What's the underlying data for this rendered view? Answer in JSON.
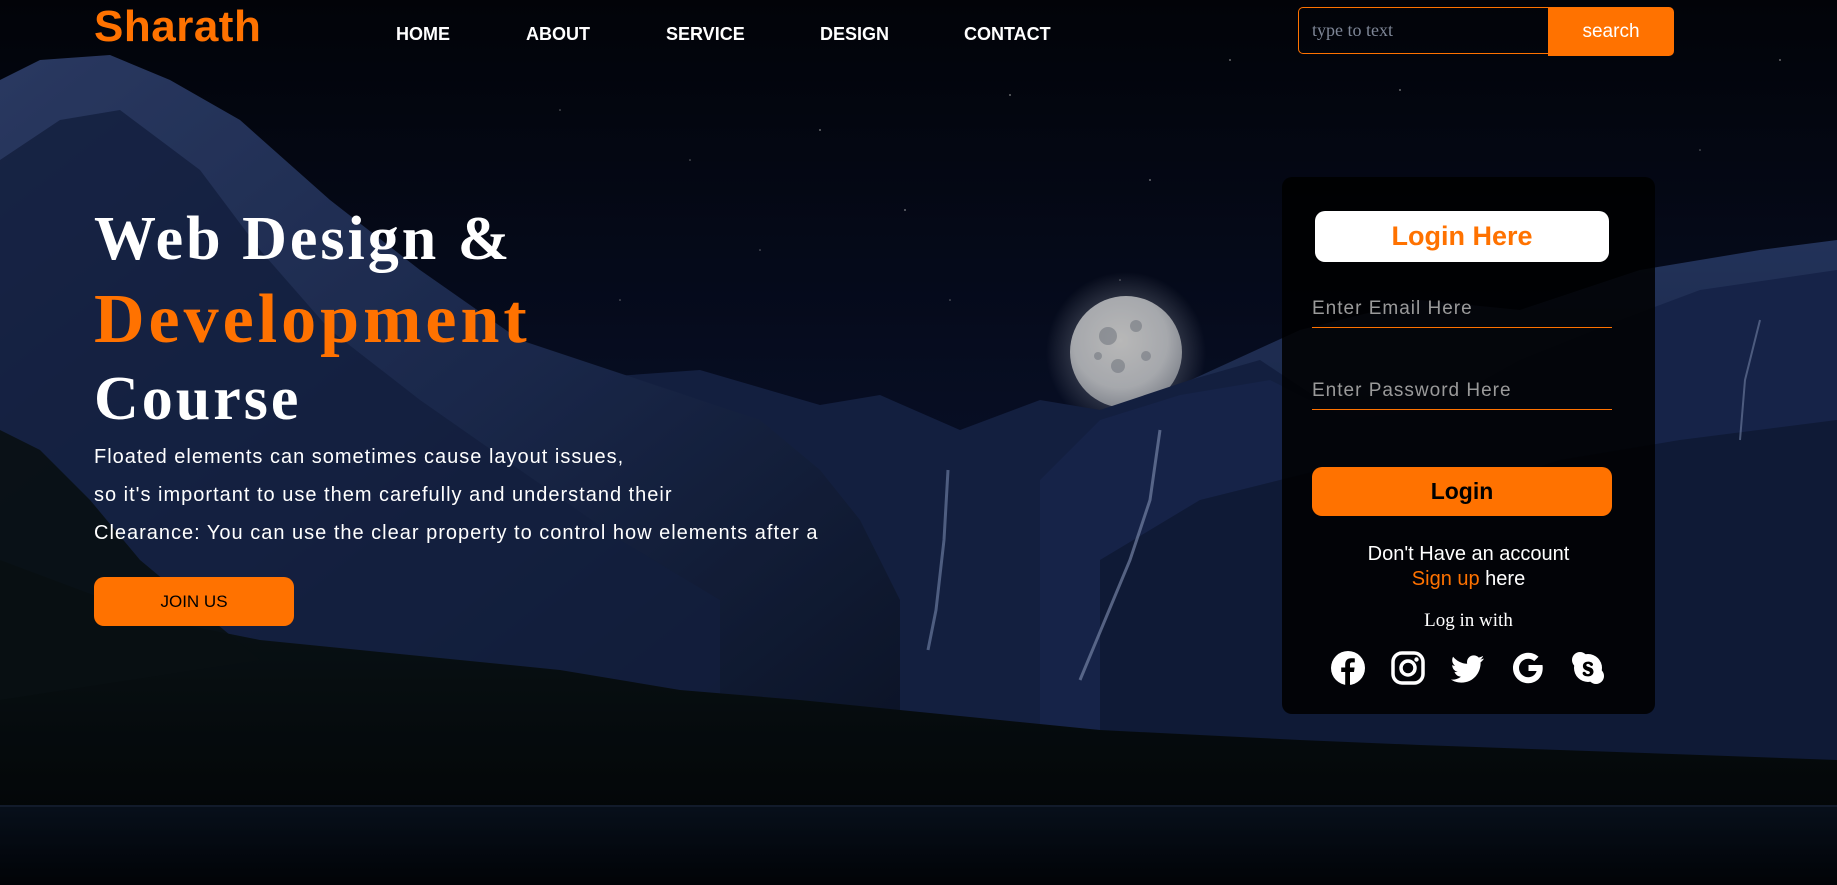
{
  "brand": {
    "name": "Sharath",
    "accent": "#ff7200"
  },
  "nav": {
    "items": [
      "HOME",
      "ABOUT",
      "SERVICE",
      "DESIGN",
      "CONTACT"
    ]
  },
  "search": {
    "placeholder": "type to text",
    "button_label": "search"
  },
  "hero": {
    "line1": "Web Design &",
    "line2": "Development",
    "line3": "Course",
    "paragraph": [
      "Floated elements can sometimes cause layout issues,",
      "so it's important to use them carefully and understand their",
      "Clearance: You can use the clear property to control how elements after a"
    ],
    "join_label": "JOIN US"
  },
  "login": {
    "title": "Login Here",
    "email_placeholder": "Enter Email Here",
    "password_placeholder": "Enter Password Here",
    "button_label": "Login",
    "no_account_text": "Don't Have an account",
    "signup_link": "Sign up",
    "signup_suffix": " here",
    "login_with": "Log in with",
    "social_icons": [
      "facebook-icon",
      "instagram-icon",
      "twitter-icon",
      "google-icon",
      "skype-icon"
    ]
  }
}
